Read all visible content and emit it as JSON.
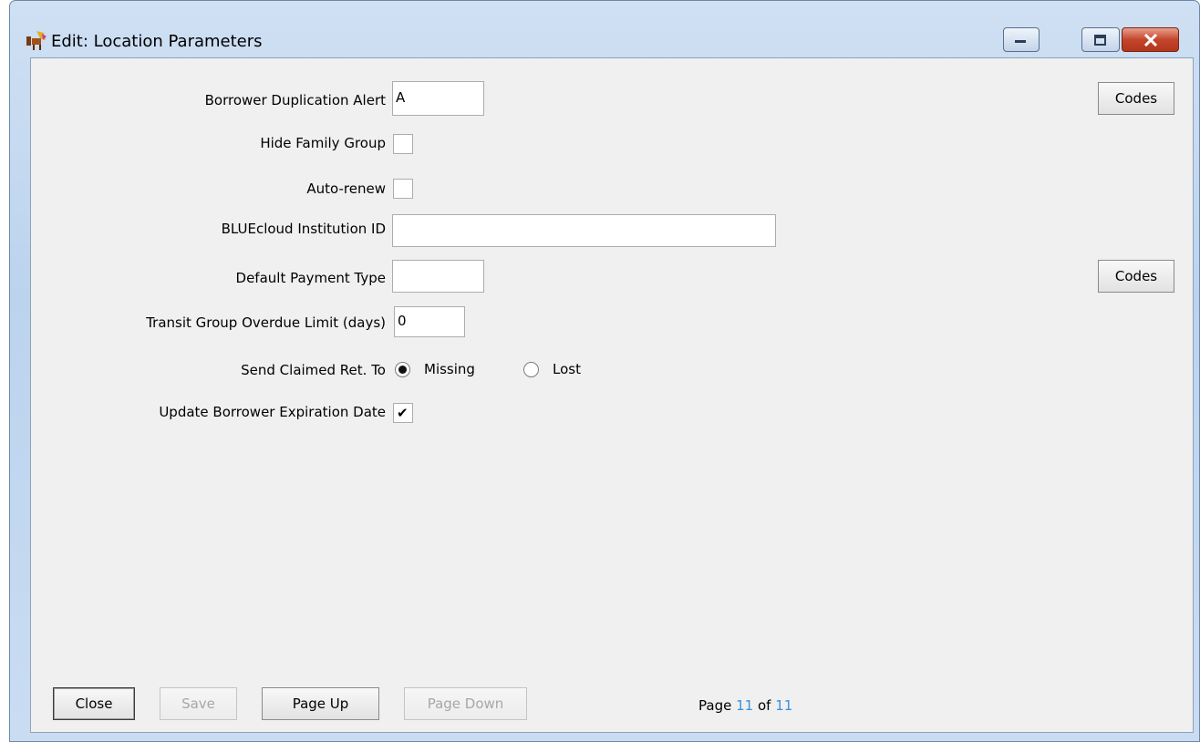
{
  "window": {
    "title": "Edit: Location Parameters",
    "icon": "app-icon"
  },
  "fields": {
    "borrower_duplication_alert": {
      "label": "Borrower Duplication Alert",
      "value": "A"
    },
    "hide_family_group": {
      "label": "Hide Family Group",
      "checked": false
    },
    "auto_renew": {
      "label": "Auto-renew",
      "checked": false
    },
    "bluecloud_institution_id": {
      "label": "BLUEcloud Institution ID",
      "value": ""
    },
    "default_payment_type": {
      "label": "Default Payment Type",
      "value": ""
    },
    "transit_group_overdue_limit": {
      "label": "Transit Group Overdue Limit (days)",
      "value": "0"
    },
    "send_claimed_ret_to": {
      "label": "Send Claimed Ret. To",
      "options": [
        "Missing",
        "Lost"
      ],
      "selected": "Missing"
    },
    "update_borrower_expiration_date": {
      "label": "Update Borrower Expiration Date",
      "checked": true
    }
  },
  "codes_buttons": [
    "Codes",
    "Codes"
  ],
  "footer": {
    "close_label": "Close",
    "save_label": "Save",
    "page_up_label": "Page Up",
    "page_down_label": "Page Down",
    "page_prefix": "Page",
    "page_current": "11",
    "page_of": "of",
    "page_total": "11"
  },
  "colors": {
    "page_number": "#3b8fde",
    "close_button": "#c4452a"
  }
}
